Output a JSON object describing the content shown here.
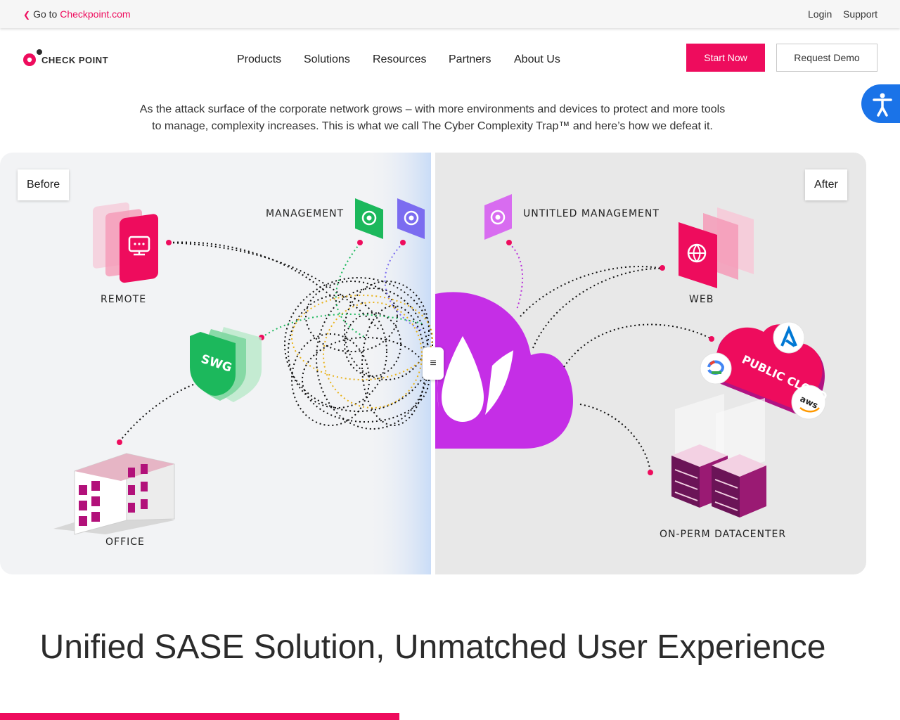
{
  "topbar": {
    "goto_prefix": "Go to",
    "goto_link": "Checkpoint.com",
    "login": "Login",
    "support": "Support"
  },
  "header": {
    "logo_text": "CHECK POINT",
    "nav": [
      "Products",
      "Solutions",
      "Resources",
      "Partners",
      "About Us"
    ],
    "start_now": "Start Now",
    "request_demo": "Request Demo"
  },
  "intro": {
    "line1": "As the attack surface of the corporate network grows – with more environments and devices to protect and more tools",
    "line2": "to manage, complexity increases. This is what we call The Cyber Complexity Trap™ and here’s how we defeat it."
  },
  "comparison": {
    "before_label": "Before",
    "after_label": "After",
    "before_nodes": {
      "management": "MANAGEMENT",
      "remote": "REMOTE",
      "swg": "SWG",
      "office": "OFFICE"
    },
    "after_nodes": {
      "management": "UNTITLED MANAGEMENT",
      "web": "WEB",
      "public_cloud": "PUBLIC CLOUD",
      "datacenter": "ON-PERM DATACENTER",
      "aws": "aws"
    }
  },
  "headline": "Unified SASE Solution, Unmatched User Experience",
  "colors": {
    "brand": "#ee0c5d",
    "cloud_purple": "#c52ee6",
    "green": "#1cb85c",
    "violet": "#7b6cf0",
    "accessibility_blue": "#1a73e8"
  }
}
